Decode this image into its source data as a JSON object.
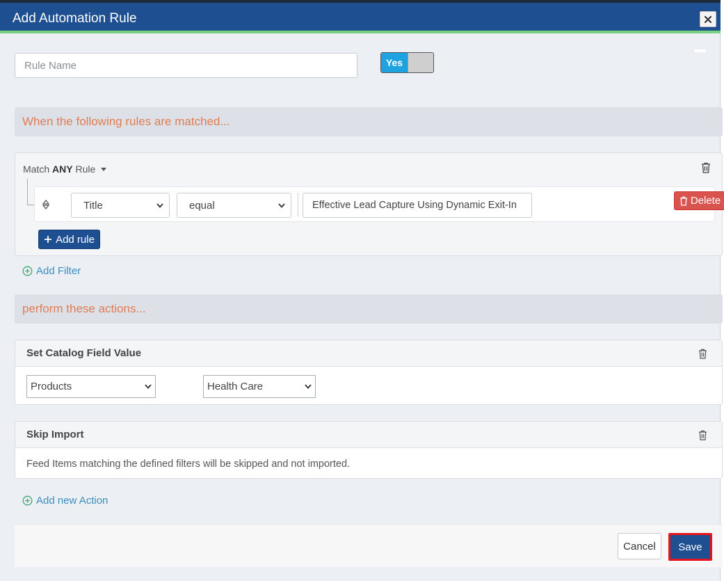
{
  "modal": {
    "title": "Add Automation Rule"
  },
  "form": {
    "rule_name_placeholder": "Rule Name",
    "rule_name_value": "",
    "toggle_label": "Yes",
    "toggle_on": true
  },
  "sections": {
    "conditions_heading": "When the following rules are matched...",
    "actions_heading": "perform these actions..."
  },
  "rules": {
    "match_prefix": "Match",
    "match_mode": "ANY",
    "match_suffix": "Rule",
    "rows": [
      {
        "field": "Title",
        "operator": "equal",
        "value": "Effective Lead Capture Using Dynamic Exit-In",
        "delete_label": "Delete"
      }
    ],
    "add_rule_label": "Add rule"
  },
  "links": {
    "add_filter": "Add Filter",
    "add_action": "Add new Action"
  },
  "actions": [
    {
      "title": "Set Catalog Field Value",
      "field_select": "Products",
      "value_select": "Health Care"
    },
    {
      "title": "Skip Import",
      "description": "Feed Items matching the defined filters will be skipped and not imported."
    }
  ],
  "footer": {
    "cancel_label": "Cancel",
    "save_label": "Save"
  },
  "colors": {
    "header": "#1d4f91",
    "header_accent": "#79d27f",
    "section_heading": "#e07c55",
    "toggle_on": "#1fa2e0",
    "delete": "#d9534f",
    "link": "#3a8fc2",
    "save_highlight": "#e8141c"
  }
}
